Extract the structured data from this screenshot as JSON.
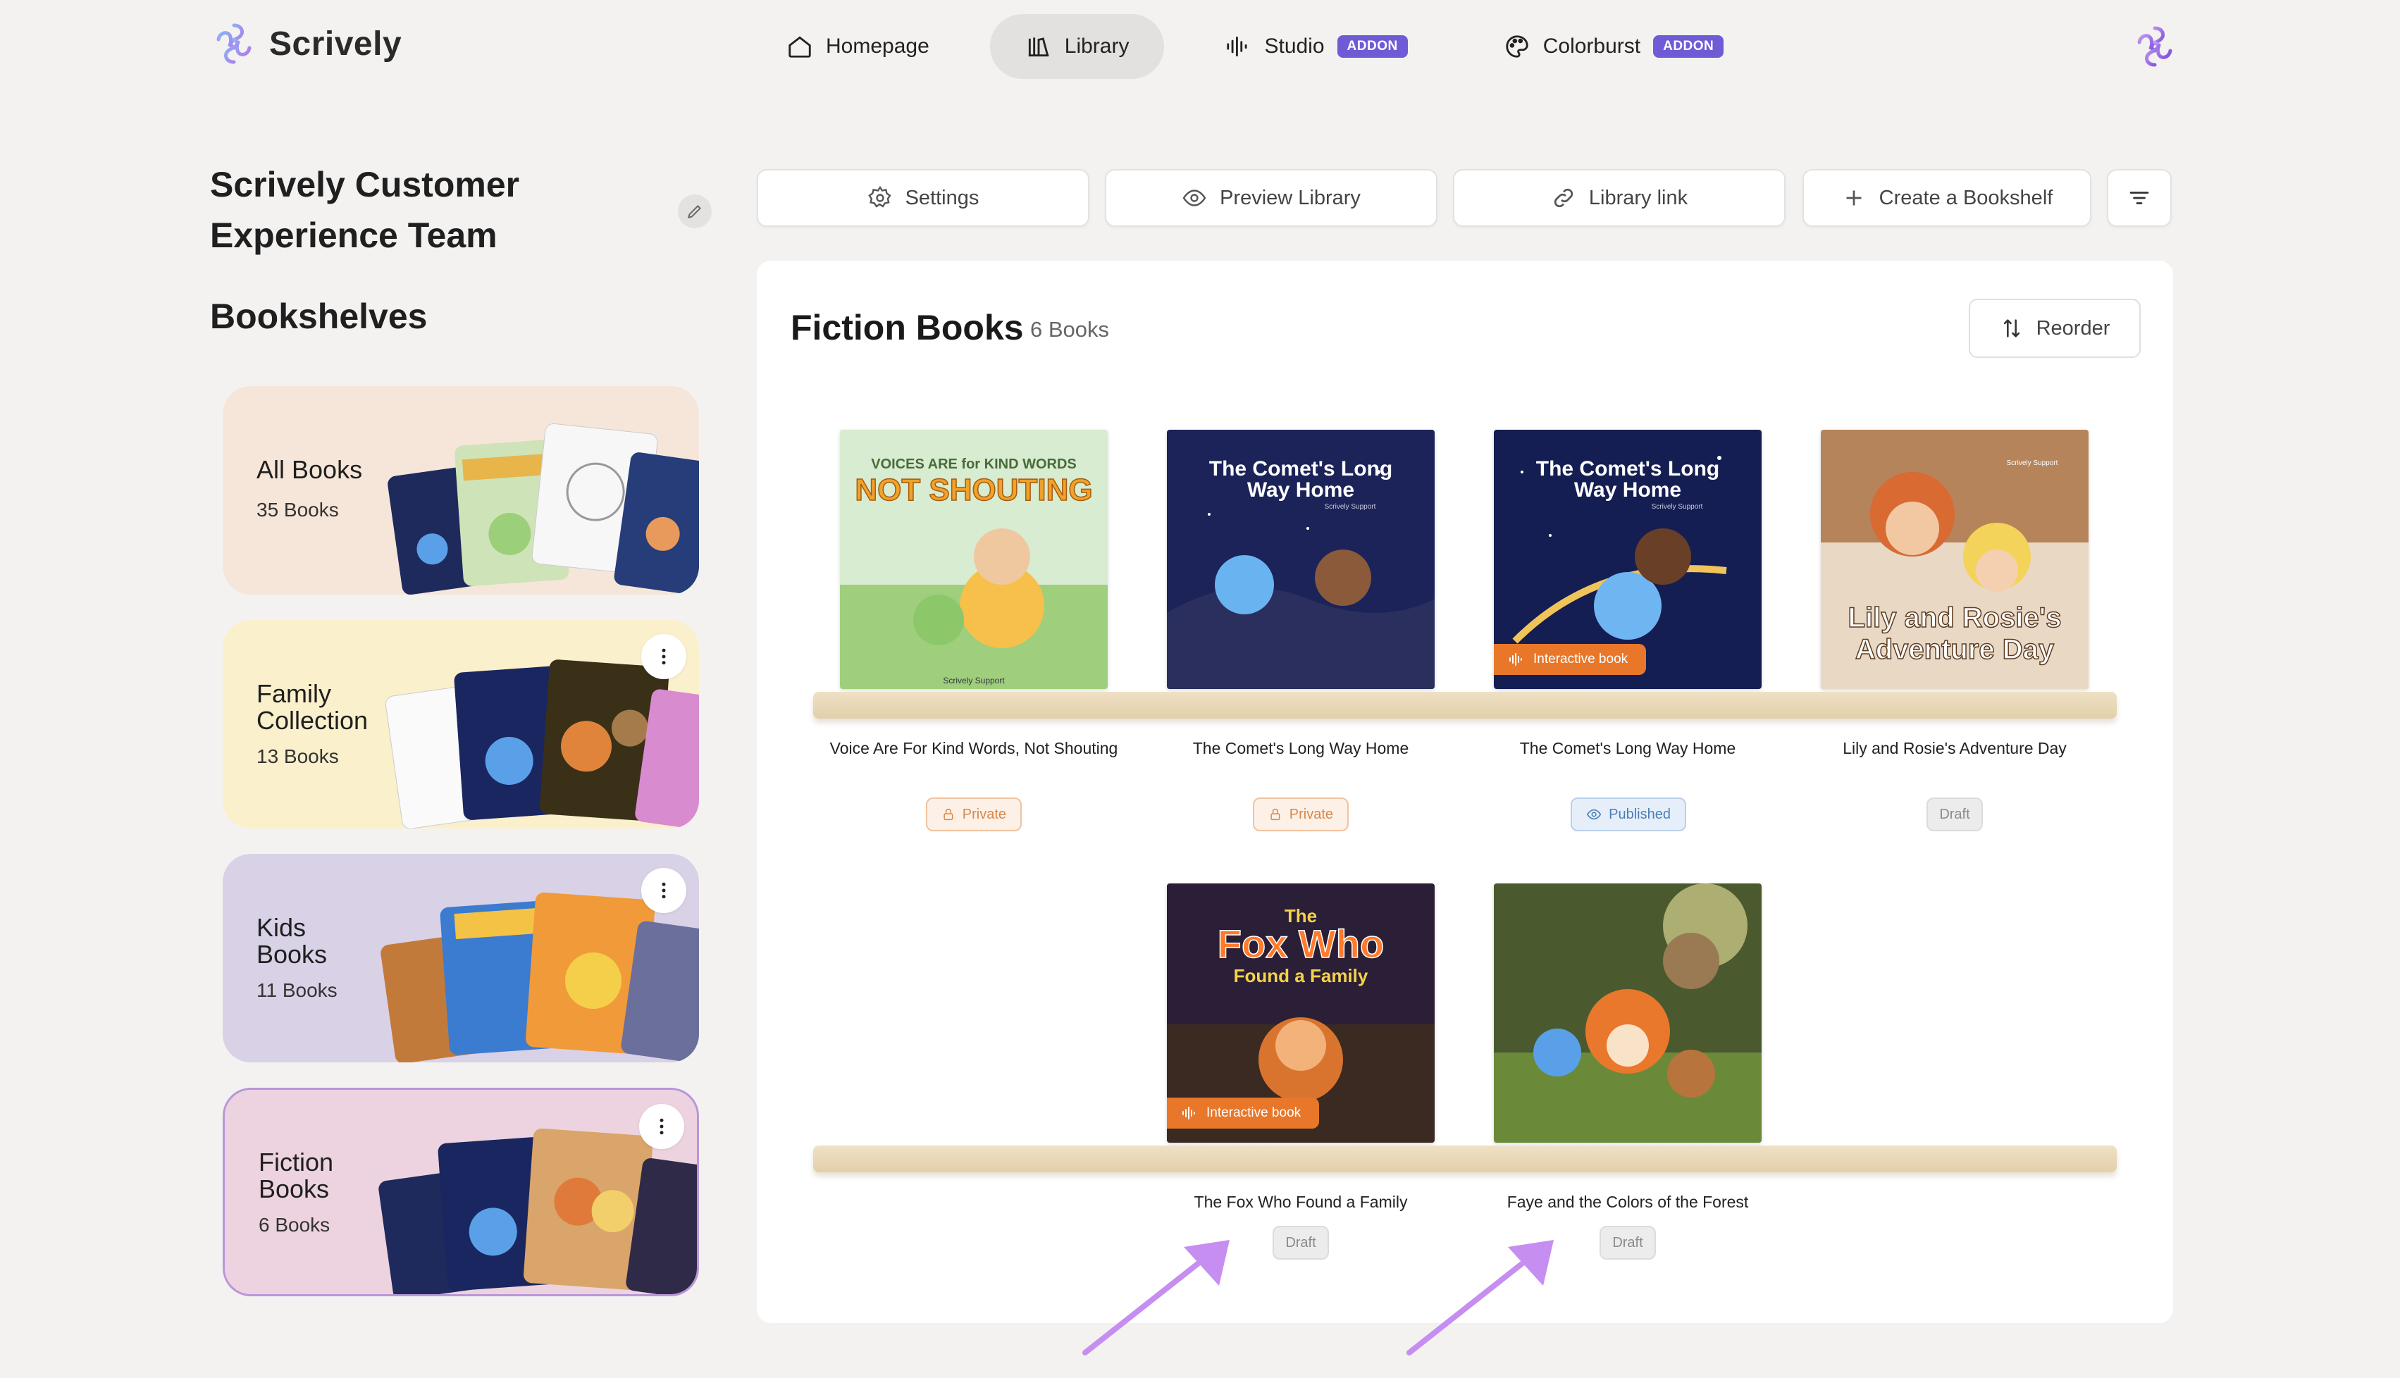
{
  "app": {
    "name": "Scrively"
  },
  "nav": [
    {
      "label": "Homepage",
      "icon": "home-icon",
      "active": false
    },
    {
      "label": "Library",
      "icon": "library-icon",
      "active": true
    },
    {
      "label": "Studio",
      "icon": "audio-wave-icon",
      "badge": "ADDON"
    },
    {
      "label": "Colorburst",
      "icon": "palette-icon",
      "badge": "ADDON"
    }
  ],
  "team": {
    "name": "Scrively Customer Experience Team"
  },
  "sidebar": {
    "heading": "Bookshelves",
    "shelves": [
      {
        "name": "All Books",
        "count": "35 Books",
        "bg": "#f6e6da"
      },
      {
        "name": "Family Collection",
        "count": "13 Books",
        "bg": "#fbf0cc"
      },
      {
        "name": "Kids Books",
        "count": "11 Books",
        "bg": "#d9d1e6"
      },
      {
        "name": "Fiction Books",
        "count": "6 Books",
        "bg": "#ecd3df"
      }
    ]
  },
  "toolbar": {
    "settings": "Settings",
    "preview": "Preview Library",
    "link": "Library link",
    "create": "Create a Bookshelf"
  },
  "shelf": {
    "title": "Fiction Books",
    "count": "6 Books",
    "reorder": "Reorder",
    "interactive_label": "Interactive book",
    "books": [
      {
        "title": "Voice Are For Kind Words, Not Shouting",
        "status": "Private",
        "cover_text_1": "VOICES ARE for KIND WORDS",
        "cover_text_2": "NOT SHOUTING",
        "cover_author": "Scrively Support"
      },
      {
        "title": "The Comet's Long Way Home",
        "status": "Private",
        "cover_text_1": "The Comet's Long",
        "cover_text_2": "Way Home",
        "cover_author": "Scrively Support"
      },
      {
        "title": "The Comet's Long Way Home",
        "status": "Published",
        "interactive": true,
        "cover_text_1": "The Comet's Long",
        "cover_text_2": "Way Home",
        "cover_author": "Scrively Support"
      },
      {
        "title": "Lily and Rosie's Adventure Day",
        "status": "Draft",
        "cover_text_1": "Lily and Rosie's",
        "cover_text_2": "Adventure Day",
        "cover_author": "Scrively Support"
      },
      {
        "title": "The Fox Who Found a Family",
        "status": "Draft",
        "interactive": true,
        "cover_text_1": "The",
        "cover_text_2": "Fox Who",
        "cover_text_3": "Found a Family"
      },
      {
        "title": "Faye and the Colors of the Forest",
        "status": "Draft"
      }
    ]
  },
  "colors": {
    "accent": "#6f5bd6",
    "interactive": "#e8772a",
    "arrow": "#c58ef0"
  }
}
